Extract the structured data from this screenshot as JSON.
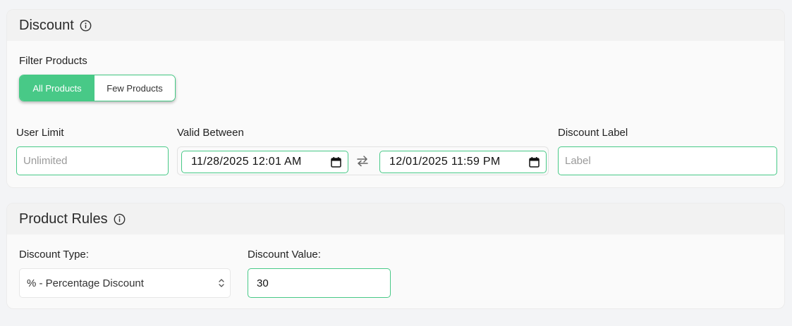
{
  "discount_section": {
    "title": "Discount",
    "filter_label": "Filter Products",
    "filter_options": [
      "All Products",
      "Few Products"
    ],
    "filter_selected": "All Products",
    "user_limit_label": "User Limit",
    "user_limit_placeholder": "Unlimited",
    "valid_between_label": "Valid Between",
    "valid_from": "11/28/2025 12:01 AM",
    "valid_to": "12/01/2025 11:59 PM",
    "discount_label_label": "Discount Label",
    "discount_label_placeholder": "Label"
  },
  "product_rules_section": {
    "title": "Product Rules",
    "discount_type_label": "Discount Type:",
    "discount_type_value": "% - Percentage Discount",
    "discount_value_label": "Discount Value:",
    "discount_value": "30"
  },
  "colors": {
    "accent": "#48c987",
    "card_bg": "#fafafa",
    "header_bg": "#f2f2f2",
    "page_bg": "#f3f4f6"
  }
}
